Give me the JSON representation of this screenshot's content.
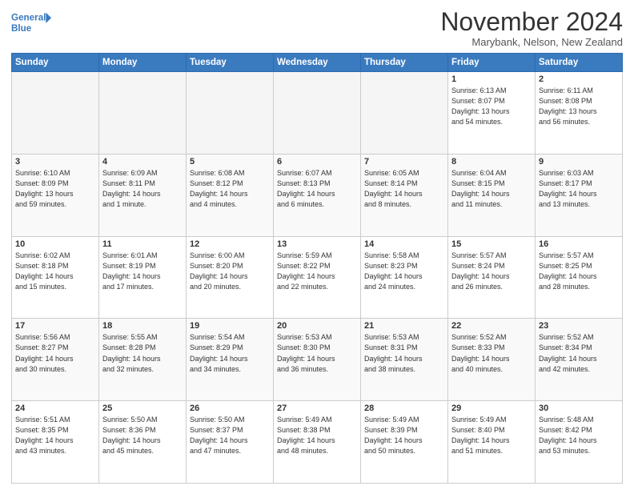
{
  "header": {
    "logo_line1": "General",
    "logo_line2": "Blue",
    "month": "November 2024",
    "location": "Marybank, Nelson, New Zealand"
  },
  "weekdays": [
    "Sunday",
    "Monday",
    "Tuesday",
    "Wednesday",
    "Thursday",
    "Friday",
    "Saturday"
  ],
  "weeks": [
    [
      {
        "day": "",
        "info": ""
      },
      {
        "day": "",
        "info": ""
      },
      {
        "day": "",
        "info": ""
      },
      {
        "day": "",
        "info": ""
      },
      {
        "day": "",
        "info": ""
      },
      {
        "day": "1",
        "info": "Sunrise: 6:13 AM\nSunset: 8:07 PM\nDaylight: 13 hours\nand 54 minutes."
      },
      {
        "day": "2",
        "info": "Sunrise: 6:11 AM\nSunset: 8:08 PM\nDaylight: 13 hours\nand 56 minutes."
      }
    ],
    [
      {
        "day": "3",
        "info": "Sunrise: 6:10 AM\nSunset: 8:09 PM\nDaylight: 13 hours\nand 59 minutes."
      },
      {
        "day": "4",
        "info": "Sunrise: 6:09 AM\nSunset: 8:11 PM\nDaylight: 14 hours\nand 1 minute."
      },
      {
        "day": "5",
        "info": "Sunrise: 6:08 AM\nSunset: 8:12 PM\nDaylight: 14 hours\nand 4 minutes."
      },
      {
        "day": "6",
        "info": "Sunrise: 6:07 AM\nSunset: 8:13 PM\nDaylight: 14 hours\nand 6 minutes."
      },
      {
        "day": "7",
        "info": "Sunrise: 6:05 AM\nSunset: 8:14 PM\nDaylight: 14 hours\nand 8 minutes."
      },
      {
        "day": "8",
        "info": "Sunrise: 6:04 AM\nSunset: 8:15 PM\nDaylight: 14 hours\nand 11 minutes."
      },
      {
        "day": "9",
        "info": "Sunrise: 6:03 AM\nSunset: 8:17 PM\nDaylight: 14 hours\nand 13 minutes."
      }
    ],
    [
      {
        "day": "10",
        "info": "Sunrise: 6:02 AM\nSunset: 8:18 PM\nDaylight: 14 hours\nand 15 minutes."
      },
      {
        "day": "11",
        "info": "Sunrise: 6:01 AM\nSunset: 8:19 PM\nDaylight: 14 hours\nand 17 minutes."
      },
      {
        "day": "12",
        "info": "Sunrise: 6:00 AM\nSunset: 8:20 PM\nDaylight: 14 hours\nand 20 minutes."
      },
      {
        "day": "13",
        "info": "Sunrise: 5:59 AM\nSunset: 8:22 PM\nDaylight: 14 hours\nand 22 minutes."
      },
      {
        "day": "14",
        "info": "Sunrise: 5:58 AM\nSunset: 8:23 PM\nDaylight: 14 hours\nand 24 minutes."
      },
      {
        "day": "15",
        "info": "Sunrise: 5:57 AM\nSunset: 8:24 PM\nDaylight: 14 hours\nand 26 minutes."
      },
      {
        "day": "16",
        "info": "Sunrise: 5:57 AM\nSunset: 8:25 PM\nDaylight: 14 hours\nand 28 minutes."
      }
    ],
    [
      {
        "day": "17",
        "info": "Sunrise: 5:56 AM\nSunset: 8:27 PM\nDaylight: 14 hours\nand 30 minutes."
      },
      {
        "day": "18",
        "info": "Sunrise: 5:55 AM\nSunset: 8:28 PM\nDaylight: 14 hours\nand 32 minutes."
      },
      {
        "day": "19",
        "info": "Sunrise: 5:54 AM\nSunset: 8:29 PM\nDaylight: 14 hours\nand 34 minutes."
      },
      {
        "day": "20",
        "info": "Sunrise: 5:53 AM\nSunset: 8:30 PM\nDaylight: 14 hours\nand 36 minutes."
      },
      {
        "day": "21",
        "info": "Sunrise: 5:53 AM\nSunset: 8:31 PM\nDaylight: 14 hours\nand 38 minutes."
      },
      {
        "day": "22",
        "info": "Sunrise: 5:52 AM\nSunset: 8:33 PM\nDaylight: 14 hours\nand 40 minutes."
      },
      {
        "day": "23",
        "info": "Sunrise: 5:52 AM\nSunset: 8:34 PM\nDaylight: 14 hours\nand 42 minutes."
      }
    ],
    [
      {
        "day": "24",
        "info": "Sunrise: 5:51 AM\nSunset: 8:35 PM\nDaylight: 14 hours\nand 43 minutes."
      },
      {
        "day": "25",
        "info": "Sunrise: 5:50 AM\nSunset: 8:36 PM\nDaylight: 14 hours\nand 45 minutes."
      },
      {
        "day": "26",
        "info": "Sunrise: 5:50 AM\nSunset: 8:37 PM\nDaylight: 14 hours\nand 47 minutes."
      },
      {
        "day": "27",
        "info": "Sunrise: 5:49 AM\nSunset: 8:38 PM\nDaylight: 14 hours\nand 48 minutes."
      },
      {
        "day": "28",
        "info": "Sunrise: 5:49 AM\nSunset: 8:39 PM\nDaylight: 14 hours\nand 50 minutes."
      },
      {
        "day": "29",
        "info": "Sunrise: 5:49 AM\nSunset: 8:40 PM\nDaylight: 14 hours\nand 51 minutes."
      },
      {
        "day": "30",
        "info": "Sunrise: 5:48 AM\nSunset: 8:42 PM\nDaylight: 14 hours\nand 53 minutes."
      }
    ]
  ]
}
